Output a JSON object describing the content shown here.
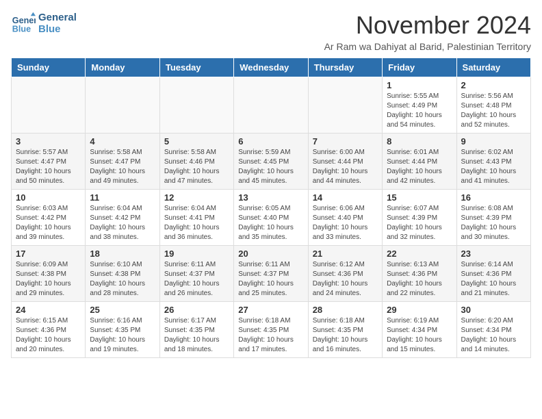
{
  "logo": {
    "line1": "General",
    "line2": "Blue"
  },
  "title": "November 2024",
  "subtitle": "Ar Ram wa Dahiyat al Barid, Palestinian Territory",
  "weekdays": [
    "Sunday",
    "Monday",
    "Tuesday",
    "Wednesday",
    "Thursday",
    "Friday",
    "Saturday"
  ],
  "weeks": [
    [
      {
        "day": "",
        "info": ""
      },
      {
        "day": "",
        "info": ""
      },
      {
        "day": "",
        "info": ""
      },
      {
        "day": "",
        "info": ""
      },
      {
        "day": "",
        "info": ""
      },
      {
        "day": "1",
        "info": "Sunrise: 5:55 AM\nSunset: 4:49 PM\nDaylight: 10 hours\nand 54 minutes."
      },
      {
        "day": "2",
        "info": "Sunrise: 5:56 AM\nSunset: 4:48 PM\nDaylight: 10 hours\nand 52 minutes."
      }
    ],
    [
      {
        "day": "3",
        "info": "Sunrise: 5:57 AM\nSunset: 4:47 PM\nDaylight: 10 hours\nand 50 minutes."
      },
      {
        "day": "4",
        "info": "Sunrise: 5:58 AM\nSunset: 4:47 PM\nDaylight: 10 hours\nand 49 minutes."
      },
      {
        "day": "5",
        "info": "Sunrise: 5:58 AM\nSunset: 4:46 PM\nDaylight: 10 hours\nand 47 minutes."
      },
      {
        "day": "6",
        "info": "Sunrise: 5:59 AM\nSunset: 4:45 PM\nDaylight: 10 hours\nand 45 minutes."
      },
      {
        "day": "7",
        "info": "Sunrise: 6:00 AM\nSunset: 4:44 PM\nDaylight: 10 hours\nand 44 minutes."
      },
      {
        "day": "8",
        "info": "Sunrise: 6:01 AM\nSunset: 4:44 PM\nDaylight: 10 hours\nand 42 minutes."
      },
      {
        "day": "9",
        "info": "Sunrise: 6:02 AM\nSunset: 4:43 PM\nDaylight: 10 hours\nand 41 minutes."
      }
    ],
    [
      {
        "day": "10",
        "info": "Sunrise: 6:03 AM\nSunset: 4:42 PM\nDaylight: 10 hours\nand 39 minutes."
      },
      {
        "day": "11",
        "info": "Sunrise: 6:04 AM\nSunset: 4:42 PM\nDaylight: 10 hours\nand 38 minutes."
      },
      {
        "day": "12",
        "info": "Sunrise: 6:04 AM\nSunset: 4:41 PM\nDaylight: 10 hours\nand 36 minutes."
      },
      {
        "day": "13",
        "info": "Sunrise: 6:05 AM\nSunset: 4:40 PM\nDaylight: 10 hours\nand 35 minutes."
      },
      {
        "day": "14",
        "info": "Sunrise: 6:06 AM\nSunset: 4:40 PM\nDaylight: 10 hours\nand 33 minutes."
      },
      {
        "day": "15",
        "info": "Sunrise: 6:07 AM\nSunset: 4:39 PM\nDaylight: 10 hours\nand 32 minutes."
      },
      {
        "day": "16",
        "info": "Sunrise: 6:08 AM\nSunset: 4:39 PM\nDaylight: 10 hours\nand 30 minutes."
      }
    ],
    [
      {
        "day": "17",
        "info": "Sunrise: 6:09 AM\nSunset: 4:38 PM\nDaylight: 10 hours\nand 29 minutes."
      },
      {
        "day": "18",
        "info": "Sunrise: 6:10 AM\nSunset: 4:38 PM\nDaylight: 10 hours\nand 28 minutes."
      },
      {
        "day": "19",
        "info": "Sunrise: 6:11 AM\nSunset: 4:37 PM\nDaylight: 10 hours\nand 26 minutes."
      },
      {
        "day": "20",
        "info": "Sunrise: 6:11 AM\nSunset: 4:37 PM\nDaylight: 10 hours\nand 25 minutes."
      },
      {
        "day": "21",
        "info": "Sunrise: 6:12 AM\nSunset: 4:36 PM\nDaylight: 10 hours\nand 24 minutes."
      },
      {
        "day": "22",
        "info": "Sunrise: 6:13 AM\nSunset: 4:36 PM\nDaylight: 10 hours\nand 22 minutes."
      },
      {
        "day": "23",
        "info": "Sunrise: 6:14 AM\nSunset: 4:36 PM\nDaylight: 10 hours\nand 21 minutes."
      }
    ],
    [
      {
        "day": "24",
        "info": "Sunrise: 6:15 AM\nSunset: 4:36 PM\nDaylight: 10 hours\nand 20 minutes."
      },
      {
        "day": "25",
        "info": "Sunrise: 6:16 AM\nSunset: 4:35 PM\nDaylight: 10 hours\nand 19 minutes."
      },
      {
        "day": "26",
        "info": "Sunrise: 6:17 AM\nSunset: 4:35 PM\nDaylight: 10 hours\nand 18 minutes."
      },
      {
        "day": "27",
        "info": "Sunrise: 6:18 AM\nSunset: 4:35 PM\nDaylight: 10 hours\nand 17 minutes."
      },
      {
        "day": "28",
        "info": "Sunrise: 6:18 AM\nSunset: 4:35 PM\nDaylight: 10 hours\nand 16 minutes."
      },
      {
        "day": "29",
        "info": "Sunrise: 6:19 AM\nSunset: 4:34 PM\nDaylight: 10 hours\nand 15 minutes."
      },
      {
        "day": "30",
        "info": "Sunrise: 6:20 AM\nSunset: 4:34 PM\nDaylight: 10 hours\nand 14 minutes."
      }
    ]
  ]
}
